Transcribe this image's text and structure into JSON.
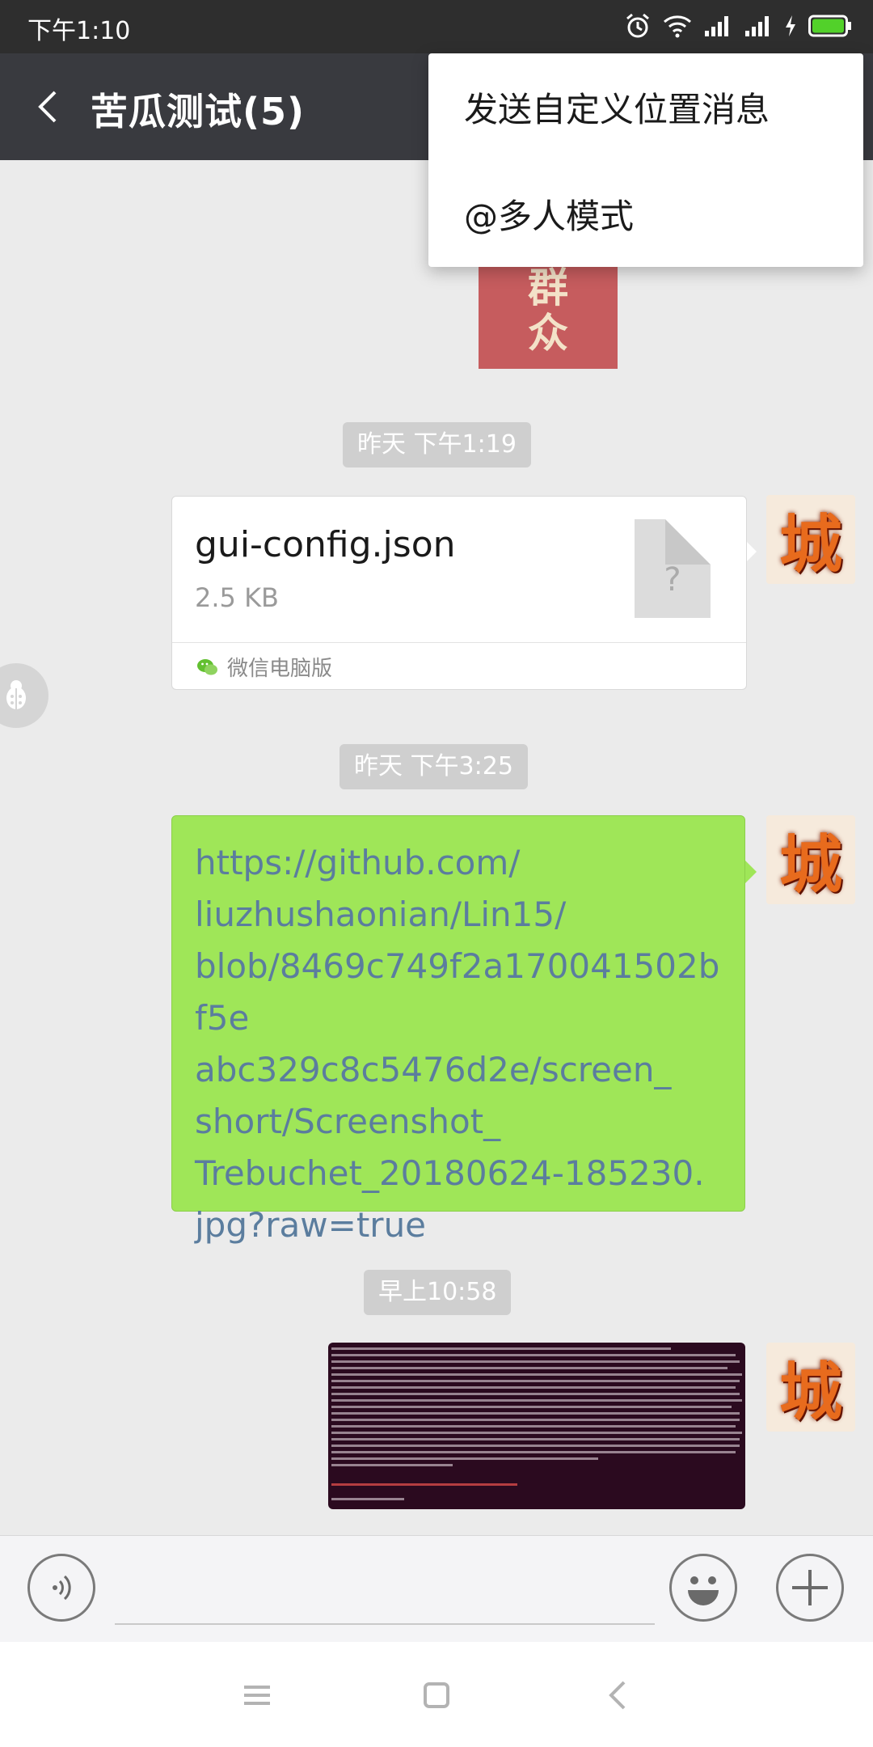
{
  "status_bar": {
    "time": "下午1:10"
  },
  "header": {
    "title": "苦瓜测试(5)"
  },
  "menu": {
    "items": [
      {
        "label": "发送自定义位置消息"
      },
      {
        "label": "@多人模式"
      }
    ]
  },
  "chat": {
    "partial_image_text": [
      "群",
      "众"
    ],
    "messages": [
      {
        "timestamp": "昨天 下午1:19",
        "type": "file",
        "file_name": "gui-config.json",
        "file_size": "2.5 KB",
        "file_icon_glyph": "?",
        "source": "微信电脑版"
      },
      {
        "timestamp": "昨天 下午3:25",
        "type": "text",
        "text": "https://github.com/\nliuzhushaonian/Lin15/\nblob/8469c749f2a170041502bf5e\nabc329c8c5476d2e/screen_\nshort/Screenshot_\nTrebuchet_20180624-185230.\njpg?raw=true"
      },
      {
        "timestamp": "早上10:58",
        "type": "image",
        "image_description_icon": "terminal-screenshot"
      }
    ],
    "avatar_char": "城"
  },
  "input": {
    "value": "",
    "placeholder": ""
  },
  "colors": {
    "titlebar": "#393a3f",
    "bubble_green": "#9fe658",
    "chat_bg": "#ebebeb",
    "link": "#5b7d9e"
  }
}
